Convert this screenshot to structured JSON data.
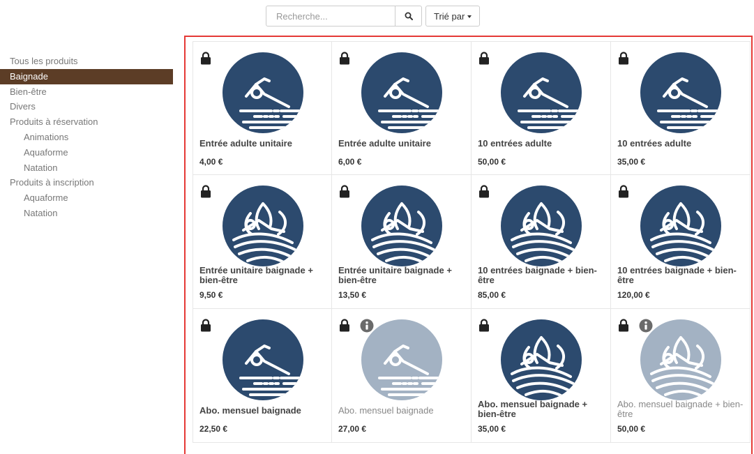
{
  "search": {
    "placeholder": "Recherche...",
    "icon": "search-icon"
  },
  "sort": {
    "label": "Trié par"
  },
  "sidebar": {
    "items": [
      {
        "label": "Tous les produits",
        "level": 0,
        "active": false
      },
      {
        "label": "Baignade",
        "level": 0,
        "active": true
      },
      {
        "label": "Bien-être",
        "level": 0,
        "active": false
      },
      {
        "label": "Divers",
        "level": 0,
        "active": false
      },
      {
        "label": "Produits à réservation",
        "level": 0,
        "active": false
      },
      {
        "label": "Animations",
        "level": 1,
        "active": false
      },
      {
        "label": "Aquaforme",
        "level": 1,
        "active": false
      },
      {
        "label": "Natation",
        "level": 1,
        "active": false
      },
      {
        "label": "Produits à inscription",
        "level": 0,
        "active": false
      },
      {
        "label": "Aquaforme",
        "level": 1,
        "active": false
      },
      {
        "label": "Natation",
        "level": 1,
        "active": false
      }
    ]
  },
  "colors": {
    "active_category": "#5c3d26",
    "product_circle": "#2c4a6e",
    "product_circle_disabled": "#a3b2c3",
    "grid_border": "#e53935"
  },
  "products": [
    {
      "name": "Entrée adulte unitaire",
      "price": "4,00 €",
      "icon": "swimmer-icon",
      "locked": true,
      "info": false,
      "disabled": false
    },
    {
      "name": "Entrée adulte unitaire",
      "price": "6,00 €",
      "icon": "swimmer-icon",
      "locked": true,
      "info": false,
      "disabled": false
    },
    {
      "name": "10 entrées adulte",
      "price": "50,00 €",
      "icon": "swimmer-icon",
      "locked": true,
      "info": false,
      "disabled": false
    },
    {
      "name": "10 entrées adulte",
      "price": "35,00 €",
      "icon": "swimmer-icon",
      "locked": true,
      "info": false,
      "disabled": false
    },
    {
      "name": "Entrée unitaire baignade + bien-être",
      "price": "9,50 €",
      "icon": "swimmer-lotus-icon",
      "locked": true,
      "info": false,
      "disabled": false
    },
    {
      "name": "Entrée unitaire baignade + bien-être",
      "price": "13,50 €",
      "icon": "swimmer-lotus-icon",
      "locked": true,
      "info": false,
      "disabled": false
    },
    {
      "name": "10 entrées baignade + bien-être",
      "price": "85,00 €",
      "icon": "swimmer-lotus-icon",
      "locked": true,
      "info": false,
      "disabled": false
    },
    {
      "name": "10 entrées baignade + bien-être",
      "price": "120,00 €",
      "icon": "swimmer-lotus-icon",
      "locked": true,
      "info": false,
      "disabled": false
    },
    {
      "name": "Abo. mensuel baignade",
      "price": "22,50 €",
      "icon": "swimmer-icon",
      "locked": true,
      "info": false,
      "disabled": false
    },
    {
      "name": "Abo. mensuel baignade",
      "price": "27,00 €",
      "icon": "swimmer-icon",
      "locked": true,
      "info": true,
      "disabled": true
    },
    {
      "name": "Abo. mensuel baignade + bien-être",
      "price": "35,00 €",
      "icon": "swimmer-lotus-icon",
      "locked": true,
      "info": false,
      "disabled": false
    },
    {
      "name": "Abo. mensuel baignade + bien-être",
      "price": "50,00 €",
      "icon": "swimmer-lotus-icon",
      "locked": true,
      "info": true,
      "disabled": true
    }
  ]
}
